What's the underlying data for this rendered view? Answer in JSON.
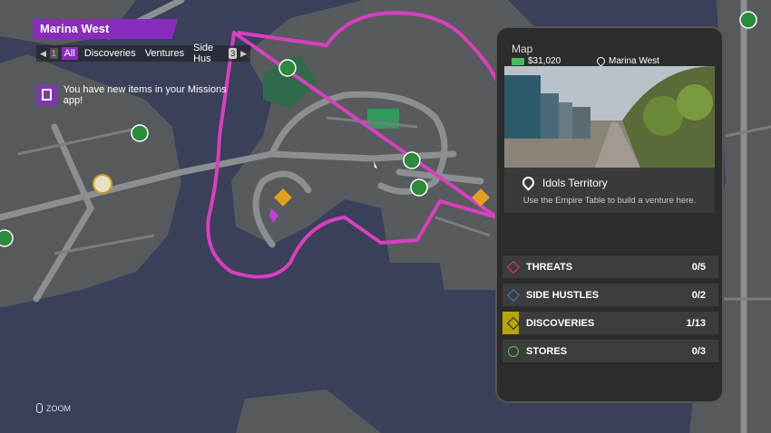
{
  "header": {
    "location_title": "Marina West"
  },
  "filter": {
    "left_key": "1",
    "right_key": "3",
    "tabs": [
      "All",
      "Discoveries",
      "Ventures",
      "Side Hus"
    ]
  },
  "notification": {
    "text": "You have new items in your Missions app!"
  },
  "hint": {
    "zoom_label": "ZOOM"
  },
  "panel": {
    "title": "Map",
    "money": "$31,020",
    "location": "Marina West",
    "territory_name": "Idols Territory",
    "territory_desc": "Use the Empire Table to build a venture here.",
    "rows": [
      {
        "label": "THREATS",
        "count": "0/5",
        "color": "#e0404a"
      },
      {
        "label": "SIDE HUSTLES",
        "count": "0/2",
        "color": "#3a7bd5"
      },
      {
        "label": "DISCOVERIES",
        "count": "1/13",
        "color": "#d4c21a"
      },
      {
        "label": "STORES",
        "count": "0/3",
        "color": "#44cc55"
      }
    ]
  },
  "colors": {
    "territory_border": "#d93fbf",
    "accent": "#8a2bbf",
    "land": "#5a5a5a",
    "water": "#3a3f5a"
  }
}
